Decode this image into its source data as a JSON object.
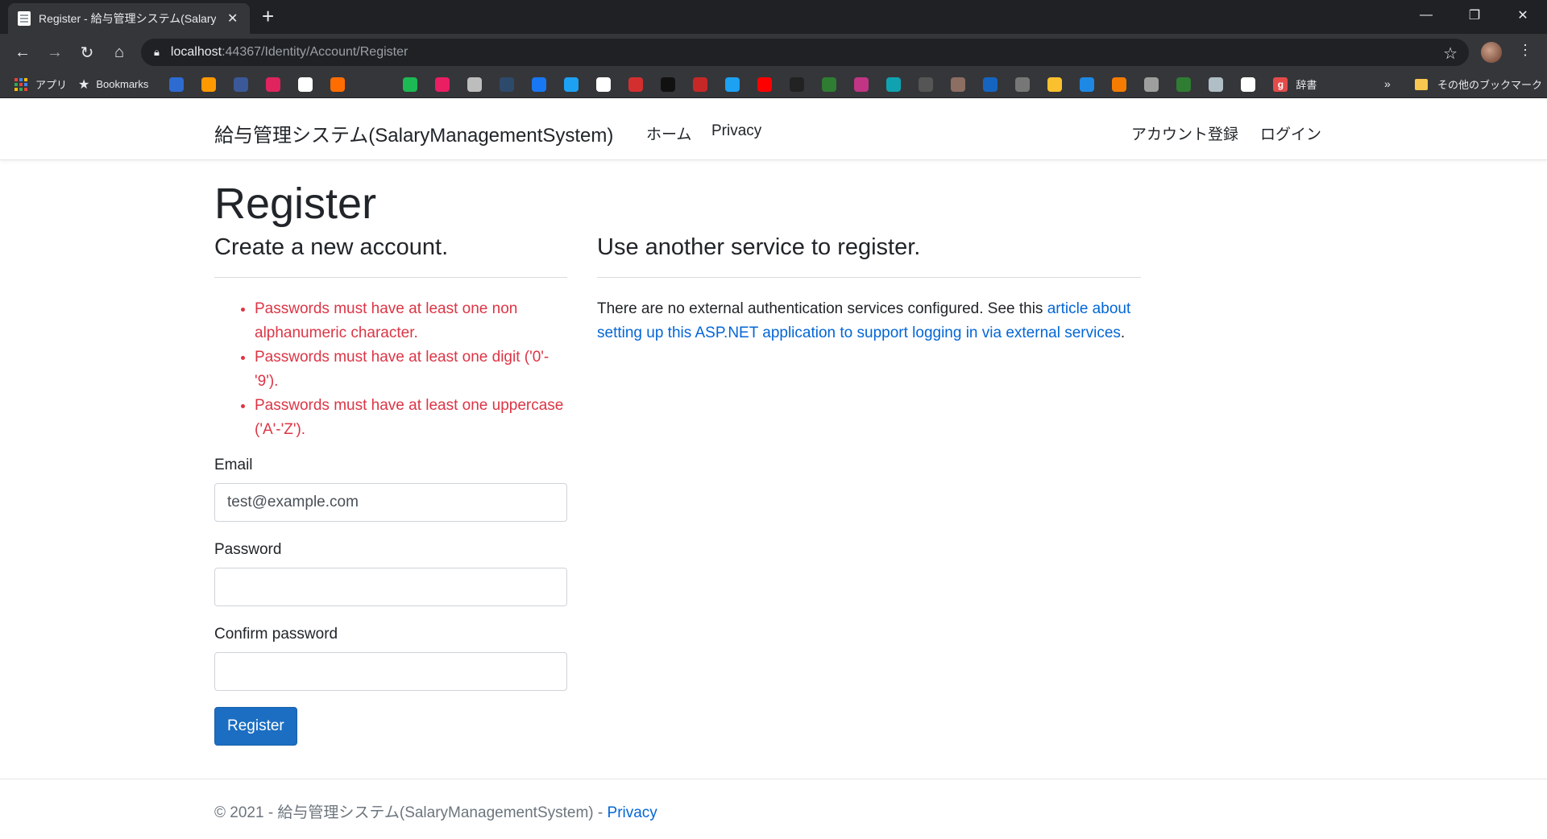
{
  "browser": {
    "tab_title": "Register - 給与管理システム(SalaryManagementSystem)",
    "tab_close": "✕",
    "new_tab": "+",
    "url_host": "localhost",
    "url_path": ":44367/Identity/Account/Register",
    "window_controls": {
      "minimize": "—",
      "restore": "❐",
      "close": "✕"
    },
    "nav": {
      "back": "←",
      "forward": "→",
      "reload": "↻",
      "home": "⌂"
    },
    "bookmarks": {
      "apps_label": "アプリ",
      "bookmarks_label": "Bookmarks",
      "dict_label": "辞書",
      "dict_glyph": "g",
      "overflow": "»",
      "other_folder": "その他のブックマーク",
      "favicon_colors": [
        "#2d6bd1",
        "#ff9900",
        "#3b5998",
        "#e0245e",
        "#ffffff",
        "#ff6d00",
        "#1db954",
        "#e91e63",
        "#bdbdbd",
        "#2e4a6b",
        "#1877f2",
        "#1da1f2",
        "#ffffff",
        "#d32f2f",
        "#111111",
        "#c62828",
        "#1da1f2",
        "#ff0000",
        "#222222",
        "#2e7d32",
        "#c13584",
        "#0fa3b1",
        "#555555",
        "#8d6e63",
        "#1565c0",
        "#777777",
        "#fbc02d",
        "#1e88e5",
        "#f57c00",
        "#9e9e9e",
        "#2e7d32",
        "#b0bec5",
        "#ffffff"
      ]
    }
  },
  "navbar": {
    "brand": "給与管理システム(SalaryManagementSystem)",
    "home": "ホーム",
    "privacy": "Privacy",
    "register": "アカウント登録",
    "login": "ログイン"
  },
  "page": {
    "title": "Register",
    "left_heading": "Create a new account.",
    "errors": [
      "Passwords must have at least one non alphanumeric character.",
      "Passwords must have at least one digit ('0'-'9').",
      "Passwords must have at least one uppercase ('A'-'Z')."
    ],
    "email_label": "Email",
    "email_value": "test@example.com",
    "password_label": "Password",
    "confirm_label": "Confirm password",
    "register_button": "Register",
    "right_heading": "Use another service to register.",
    "ext_text": "There are no external authentication services configured. See this ",
    "ext_link": "article about setting up this ASP.NET application to support logging in via external services",
    "ext_end": "."
  },
  "footer": {
    "text": "© 2021 - 給与管理システム(SalaryManagementSystem) - ",
    "privacy": "Privacy"
  }
}
